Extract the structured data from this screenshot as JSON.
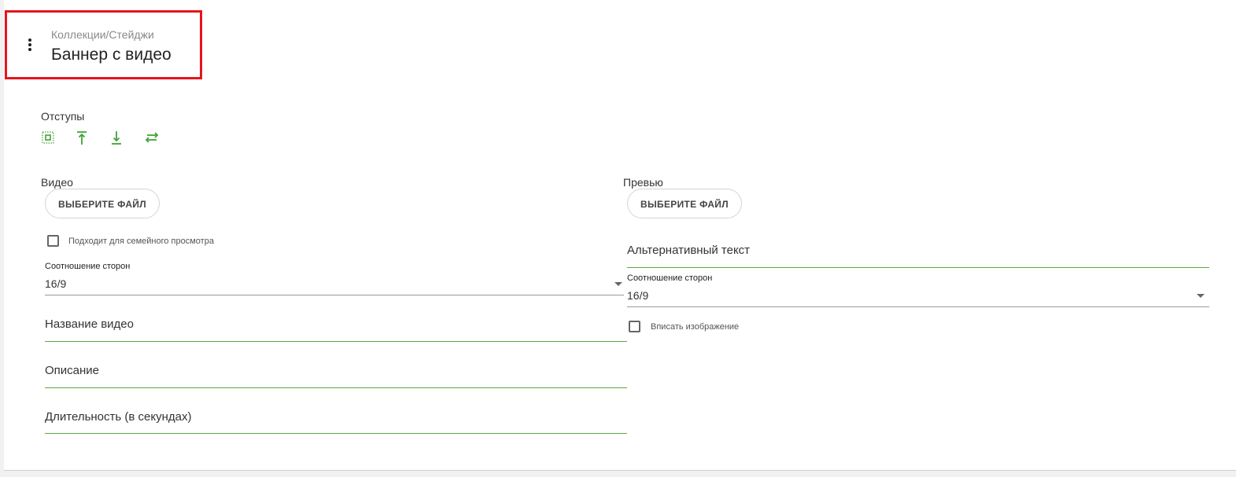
{
  "header": {
    "breadcrumb": "Коллекции/Стейджи",
    "title": "Баннер с видео",
    "menu_icon": "more-vertical-icon"
  },
  "paddings": {
    "label": "Отступы",
    "icons": [
      "padding-all-icon",
      "padding-top-icon",
      "padding-bottom-icon",
      "padding-horizontal-icon"
    ],
    "accent_color": "#3fa535"
  },
  "video": {
    "label": "Видео",
    "choose_file_label": "ВЫБЕРИТЕ ФАЙЛ",
    "family_checkbox_label": "Подходит для семейного просмотра",
    "family_checked": false,
    "aspect_caption": "Соотношение сторон",
    "aspect_value": "16/9",
    "name_placeholder": "Название видео",
    "description_placeholder": "Описание",
    "duration_placeholder": "Длительность (в секундах)"
  },
  "preview": {
    "label": "Превью",
    "choose_file_label": "ВЫБЕРИТЕ ФАЙЛ",
    "alt_text_placeholder": "Альтернативный текст",
    "aspect_caption": "Соотношение сторон",
    "aspect_value": "16/9",
    "fit_checkbox_label": "Вписать изображение",
    "fit_checked": false
  },
  "colors": {
    "highlight": "#e8141c",
    "field_underline": "#5fa83b",
    "select_underline": "#9a9a9a"
  }
}
